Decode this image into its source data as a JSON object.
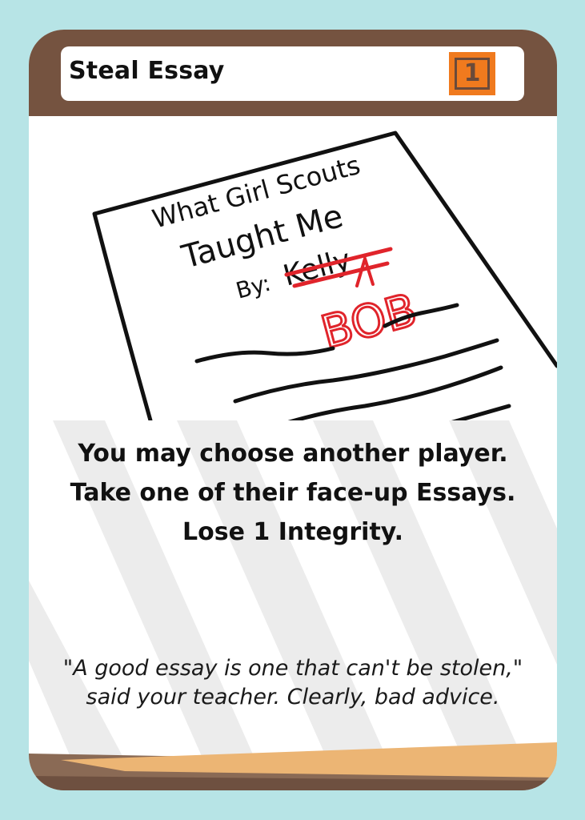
{
  "card": {
    "title": "Steal Essay",
    "cost": "1",
    "rules": [
      "You may choose another player.",
      "Take one of their face-up Essays.",
      "Lose 1 Integrity."
    ],
    "flavor": "\"A good essay is one that can't be stolen,\" said your teacher. Clearly, bad advice."
  },
  "illustration": {
    "line1": "What Girl Scouts",
    "line2": "Taught Me",
    "byline": "By:",
    "crossed_name": "Kelly",
    "new_name": "BOB"
  },
  "colors": {
    "background": "#b7e4e6",
    "header": "#755340",
    "cost_badge": "#f07a1e",
    "footer_light": "#ecb574",
    "footer_dark": "#8a6a55",
    "correction_ink": "#e0242b"
  }
}
